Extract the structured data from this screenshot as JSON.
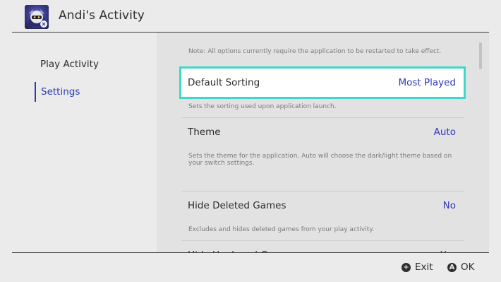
{
  "header": {
    "title": "Andi's Activity",
    "avatar_icon": "meta-knight-avatar"
  },
  "sidebar": {
    "items": [
      {
        "label": "Play Activity",
        "active": false
      },
      {
        "label": "Settings",
        "active": true
      }
    ]
  },
  "main": {
    "note": "Note: All options currently require the application to be restarted to take effect.",
    "settings": [
      {
        "label": "Default Sorting",
        "value": "Most Played",
        "description": "Sets the sorting used upon application launch.",
        "selected": true
      },
      {
        "label": "Theme",
        "value": "Auto",
        "description": "Sets the theme for the application. Auto will choose the dark/light theme based on your switch settings.",
        "selected": false
      },
      {
        "label": "Hide Deleted Games",
        "value": "No",
        "description": "Excludes and hides deleted games from your play activity.",
        "selected": false
      },
      {
        "label": "Hide Unplayed Games",
        "value": "Yes",
        "selected": false
      }
    ]
  },
  "footer": {
    "exit_label": "Exit",
    "exit_icon": "plus-button-icon",
    "ok_label": "OK",
    "ok_icon": "a-button-icon",
    "exit_glyph": "+",
    "ok_glyph": "A"
  },
  "colors": {
    "accent": "#2e3bb8",
    "selection_outline": "#3ed8c9",
    "background": "#ebebeb",
    "panel": "#e2e2e2"
  }
}
